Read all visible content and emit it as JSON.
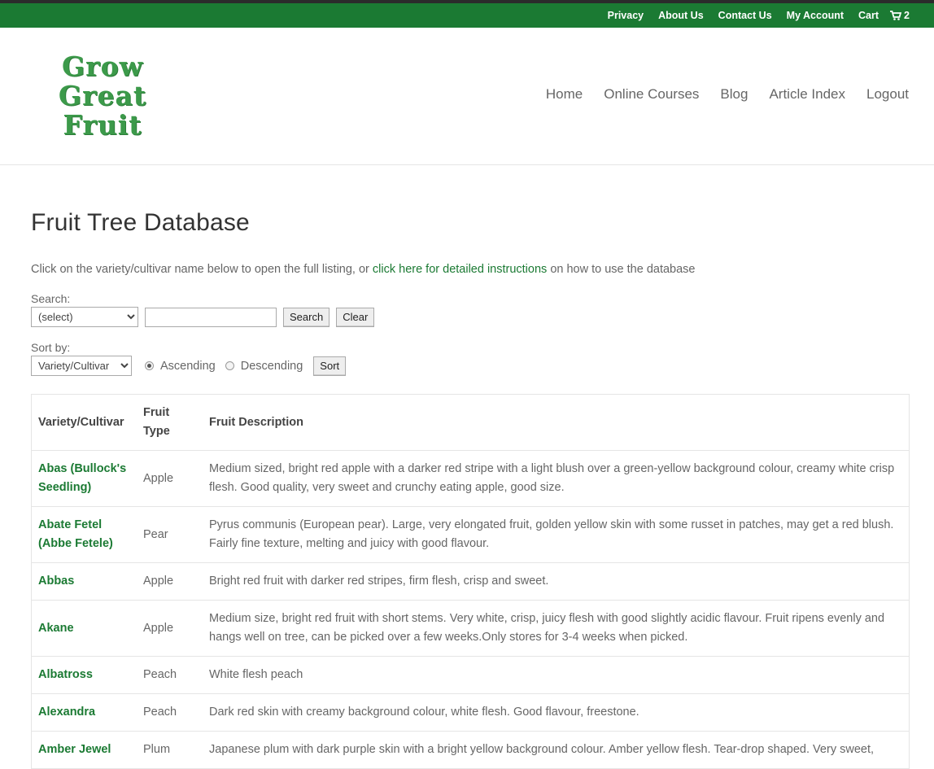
{
  "topbar": {
    "links": [
      "Privacy",
      "About Us",
      "Contact Us",
      "My Account",
      "Cart"
    ],
    "cart_count": "2"
  },
  "logo": {
    "lines": [
      "Grow",
      "Great",
      "Fruit"
    ]
  },
  "nav": [
    "Home",
    "Online Courses",
    "Blog",
    "Article Index",
    "Logout"
  ],
  "page": {
    "title": "Fruit Tree Database",
    "intro_before": "Click on the variety/cultivar name below to open the full listing, or ",
    "intro_link": "click here for detailed instructions",
    "intro_after": " on how to use the database"
  },
  "search": {
    "label": "Search:",
    "select_value": "(select)",
    "input_value": "",
    "search_button": "Search",
    "clear_button": "Clear"
  },
  "sort": {
    "label": "Sort by:",
    "select_value": "Variety/Cultivar",
    "ascending": "Ascending",
    "descending": "Descending",
    "selected": "ascending",
    "sort_button": "Sort"
  },
  "table": {
    "headers": [
      "Variety/Cultivar",
      "Fruit Type",
      "Fruit Description"
    ],
    "rows": [
      {
        "name": "Abas (Bullock's Seedling)",
        "type": "Apple",
        "desc": "Medium sized, bright red apple with a darker red stripe with a light blush over a green-yellow background colour, creamy white crisp flesh. Good quality, very sweet and crunchy eating apple, good size."
      },
      {
        "name": "Abate Fetel (Abbe Fetele)",
        "type": "Pear",
        "desc": "Pyrus communis (European pear). Large, very elongated fruit, golden yellow skin with some russet in patches, may get a red blush. Fairly fine texture, melting and juicy with good flavour."
      },
      {
        "name": "Abbas",
        "type": "Apple",
        "desc": "Bright red fruit with darker red stripes, firm flesh, crisp and sweet."
      },
      {
        "name": "Akane",
        "type": "Apple",
        "desc": "Medium size, bright red fruit with short stems. Very white, crisp, juicy flesh with good slightly acidic flavour. Fruit ripens evenly and hangs well on tree, can be picked over  a few weeks.Only stores for 3-4 weeks when picked."
      },
      {
        "name": "Albatross",
        "type": "Peach",
        "desc": "White flesh peach"
      },
      {
        "name": "Alexandra",
        "type": "Peach",
        "desc": "Dark red skin with creamy background colour, white flesh. Good flavour, freestone."
      },
      {
        "name": "Amber Jewel",
        "type": "Plum",
        "desc": "Japanese plum with dark purple skin with a bright yellow background colour. Amber yellow flesh. Tear-drop shaped. Very sweet,"
      }
    ]
  }
}
